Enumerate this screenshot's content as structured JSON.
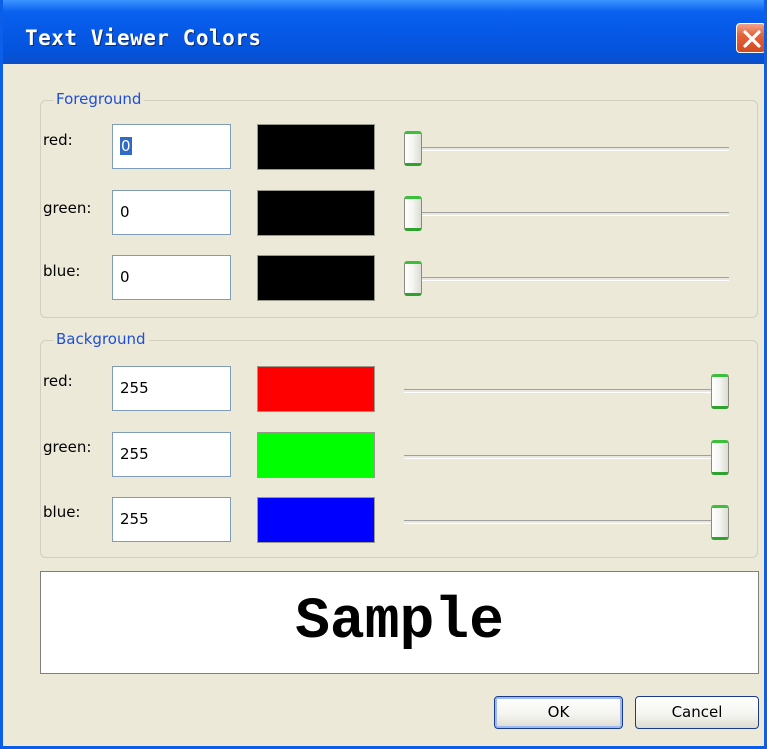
{
  "window": {
    "title": "Text Viewer Colors"
  },
  "foreground": {
    "legend": "Foreground",
    "channels": [
      {
        "label": "red:",
        "value": "0",
        "swatch": "#000000",
        "slider": 0
      },
      {
        "label": "green:",
        "value": "0",
        "swatch": "#000000",
        "slider": 0
      },
      {
        "label": "blue:",
        "value": "0",
        "swatch": "#000000",
        "slider": 0
      }
    ]
  },
  "background": {
    "legend": "Background",
    "channels": [
      {
        "label": "red:",
        "value": "255",
        "swatch": "#ff0000",
        "slider": 255
      },
      {
        "label": "green:",
        "value": "255",
        "swatch": "#00ff00",
        "slider": 255
      },
      {
        "label": "blue:",
        "value": "255",
        "swatch": "#0000ff",
        "slider": 255
      }
    ]
  },
  "sample": {
    "text": "Sample"
  },
  "buttons": {
    "ok": "OK",
    "cancel": "Cancel"
  }
}
